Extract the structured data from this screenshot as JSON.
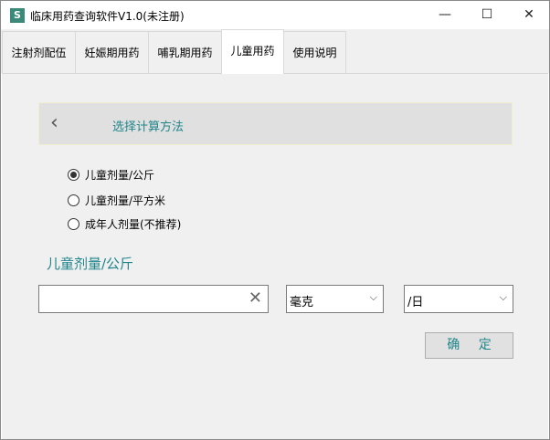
{
  "window": {
    "title": "临床用药查询软件V1.0(未注册)",
    "icon": "S",
    "minimize": "—",
    "maximize": "☐",
    "close": "✕"
  },
  "tabs": [
    {
      "label": "注射剂配伍"
    },
    {
      "label": "妊娠期用药"
    },
    {
      "label": "哺乳期用药"
    },
    {
      "label": "儿童用药",
      "selected": true
    },
    {
      "label": "使用说明"
    }
  ],
  "header": {
    "back_icon": "chevron-left",
    "title": "选择计算方法"
  },
  "radios": [
    {
      "label": "儿童剂量/公斤",
      "checked": true
    },
    {
      "label": "儿童剂量/平方米",
      "checked": false
    },
    {
      "label": "成年人剂量(不推荐)",
      "checked": false
    }
  ],
  "section_label": "儿童剂量/公斤",
  "dose_input": {
    "value": "",
    "placeholder": ""
  },
  "unit_select": {
    "value": "毫克"
  },
  "period_select": {
    "value": "/日"
  },
  "confirm_label": "确 定",
  "colors": {
    "accent": "#20858a"
  }
}
